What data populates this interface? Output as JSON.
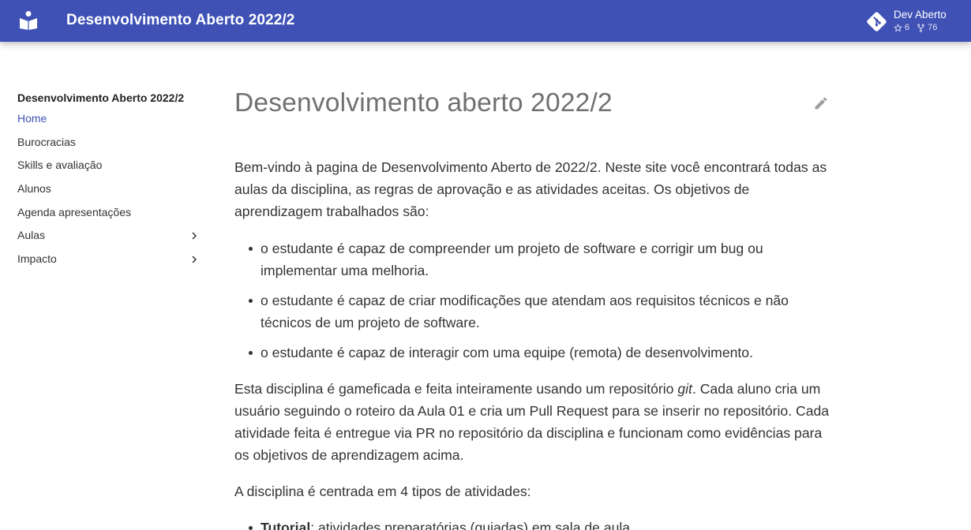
{
  "header": {
    "site_title": "Desenvolvimento Aberto 2022/2",
    "logo_icon": "book-reader-icon",
    "repo": {
      "name": "Dev Aberto",
      "stars": "6",
      "forks": "76",
      "icon": "git-icon"
    }
  },
  "nav": {
    "title": "Desenvolvimento Aberto 2022/2",
    "items": [
      {
        "label": "Home",
        "active": true
      },
      {
        "label": "Burocracias"
      },
      {
        "label": "Skills e avaliação"
      },
      {
        "label": "Alunos"
      },
      {
        "label": "Agenda apresentações"
      },
      {
        "label": "Aulas",
        "expandable": true
      },
      {
        "label": "Impacto",
        "expandable": true
      }
    ]
  },
  "content": {
    "title": "Desenvolvimento aberto 2022/2",
    "intro": "Bem-vindo à pagina de Desenvolvimento Aberto de 2022/2. Neste site você encontrará todas as aulas da disciplina, as regras de aprovação e as atividades aceitas. Os objetivos de aprendizagem trabalhados são:",
    "objectives": [
      "o estudante é capaz de compreender um projeto de software e corrigir um bug ou implementar uma melhoria.",
      "o estudante é capaz de criar modificações que atendam aos requisitos técnicos e não técnicos de um projeto de software.",
      "o estudante é capaz de interagir com uma equipe (remota) de desenvolvimento."
    ],
    "gamified": {
      "before": "Esta disciplina é gameficada e feita inteiramente usando um repositório ",
      "em": "git",
      "after": ". Cada aluno cria um usuário seguindo o roteiro da Aula 01 e cria um Pull Request para se inserir no repositório. Cada atividade feita é entregue via PR no repositório da disciplina e funcionam como evidências para os objetivos de aprendizagem acima."
    },
    "activities_intro": "A disciplina é centrada em 4 tipos de atividades:",
    "activities": [
      {
        "name": "Tutorial",
        "desc": ": atividades preparatórias (guiadas) em sala de aula."
      }
    ]
  },
  "colors": {
    "primary": "#3f51b5",
    "text": "#333333",
    "title": "#707070"
  }
}
